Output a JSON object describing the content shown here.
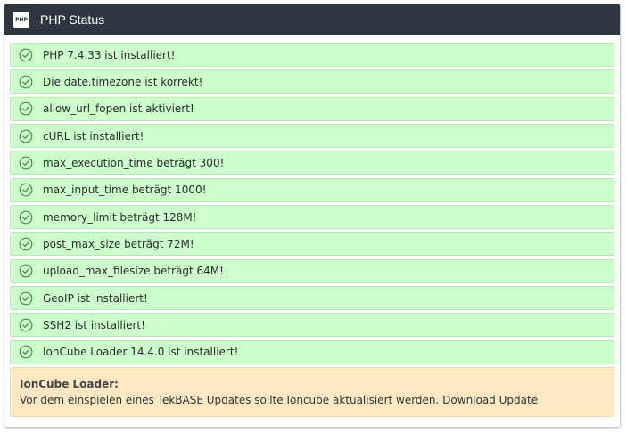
{
  "panel": {
    "icon": "php-icon",
    "icon_text": "PHP",
    "title": "PHP Status"
  },
  "rows": [
    {
      "text": "PHP 7.4.33 ist installiert!"
    },
    {
      "text": "Die date.timezone ist korrekt!"
    },
    {
      "text": "allow_url_fopen ist aktiviert!"
    },
    {
      "text": "cURL ist installiert!"
    },
    {
      "text": "max_execution_time beträgt 300!"
    },
    {
      "text": "max_input_time beträgt 1000!"
    },
    {
      "text": "memory_limit beträgt 128M!"
    },
    {
      "text": "post_max_size beträgt 72M!"
    },
    {
      "text": "upload_max_filesize beträgt 64M!"
    },
    {
      "text": "GeoIP ist installiert!"
    },
    {
      "text": "SSH2 ist installiert!"
    },
    {
      "text": "IonCube Loader 14.4.0 ist installiert!"
    }
  ],
  "notice": {
    "title": "IonCube Loader:",
    "text": "Vor dem einspielen eines TekBASE Updates sollte Ioncube aktualisiert werden. Download Update"
  },
  "colors": {
    "header_bg": "#2f3641",
    "row_bg": "#ccffcc",
    "check": "#4a8a4a",
    "notice_bg": "#fde8c4"
  }
}
